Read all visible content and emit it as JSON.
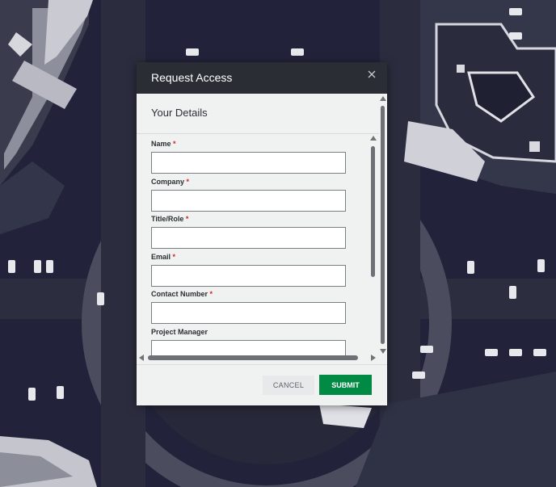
{
  "modal": {
    "title": "Request Access",
    "section_title": "Your Details"
  },
  "form": {
    "required_marker": "*",
    "fields": [
      {
        "label": "Name",
        "required": true,
        "value": ""
      },
      {
        "label": "Company",
        "required": true,
        "value": ""
      },
      {
        "label": "Title/Role",
        "required": true,
        "value": ""
      },
      {
        "label": "Email",
        "required": true,
        "value": ""
      },
      {
        "label": "Contact Number",
        "required": true,
        "value": ""
      },
      {
        "label": "Project Manager",
        "required": false,
        "value": ""
      }
    ]
  },
  "footer": {
    "cancel_label": "CANCEL",
    "submit_label": "SUBMIT"
  },
  "icons": {
    "close": "close-icon"
  },
  "colors": {
    "header_bg": "#2a2e34",
    "submit_bg": "#008a44",
    "required": "#d0252b"
  }
}
